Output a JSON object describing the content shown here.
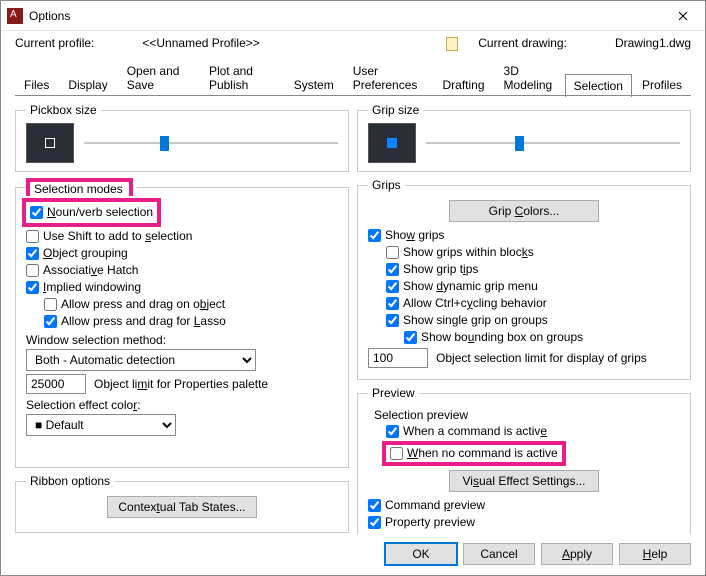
{
  "window": {
    "title": "Options"
  },
  "profile": {
    "label": "Current profile:",
    "name": "<<Unnamed Profile>>",
    "drawing_label": "Current drawing:",
    "drawing_name": "Drawing1.dwg"
  },
  "tabs": {
    "files": "Files",
    "display": "Display",
    "open_save": "Open and Save",
    "plot": "Plot and Publish",
    "system": "System",
    "user_prefs": "User Preferences",
    "drafting": "Drafting",
    "modeling": "3D Modeling",
    "selection": "Selection",
    "profiles": "Profiles"
  },
  "pickbox": {
    "legend": "Pickbox size"
  },
  "gripsize": {
    "legend": "Grip size"
  },
  "selmodes": {
    "legend": "Selection modes",
    "noun_verb": "Noun/verb selection",
    "shift_add": "Use Shift to add to selection",
    "obj_group": "Object grouping",
    "assoc_hatch": "Associative Hatch",
    "implied_win": "Implied windowing",
    "press_drag_obj": "Allow press and drag on object",
    "press_drag_lasso": "Allow press and drag for Lasso",
    "win_sel_method": "Window selection method:",
    "win_sel_value": "Both - Automatic detection",
    "obj_limit_value": "25000",
    "obj_limit_label": "Object limit for Properties palette",
    "sel_effect_color": "Selection effect color:",
    "color_value": "Default"
  },
  "ribbon": {
    "legend": "Ribbon options",
    "contextual_btn": "Contextual Tab States..."
  },
  "grips": {
    "legend": "Grips",
    "colors_btn": "Grip Colors...",
    "show_grips": "Show grips",
    "within_blocks": "Show grips within blocks",
    "grip_tips": "Show grip tips",
    "dyn_menu": "Show dynamic grip menu",
    "ctrl_cycle": "Allow Ctrl+cycling behavior",
    "single_group": "Show single grip on groups",
    "bbox_group": "Show bounding box on groups",
    "sel_limit_value": "100",
    "sel_limit_label": "Object selection limit for display of grips"
  },
  "preview": {
    "legend": "Preview",
    "sel_preview": "Selection preview",
    "when_active": "When a command is active",
    "when_none": "When no command is active",
    "visual_btn": "Visual Effect Settings...",
    "cmd_preview": "Command preview",
    "prop_preview": "Property preview"
  },
  "buttons": {
    "ok": "OK",
    "cancel": "Cancel",
    "apply": "Apply",
    "help": "Help"
  }
}
